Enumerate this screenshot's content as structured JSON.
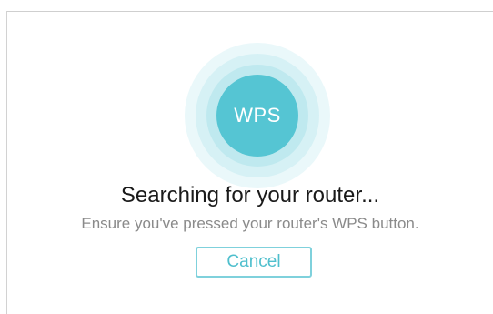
{
  "wps_dialog": {
    "badge_label": "WPS",
    "title": "Searching for your router...",
    "subtitle": "Ensure you've pressed your router's WPS button.",
    "cancel_label": "Cancel"
  },
  "colors": {
    "accent": "#55c5d3",
    "accent_light": "#d6f1f5",
    "title_text": "#1a1a1a",
    "subtitle_text": "#8a8a8a",
    "button_border": "#7fd1dc"
  },
  "icons": {
    "wps_indicator": "wps-pulse-icon"
  }
}
